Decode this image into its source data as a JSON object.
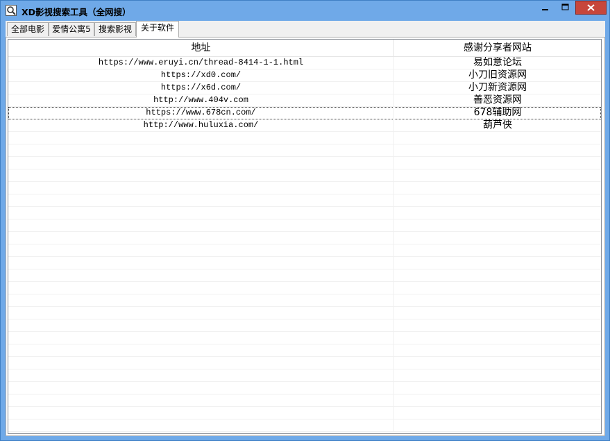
{
  "window": {
    "title": "XD影视搜索工具（全网搜）",
    "controls": {
      "minimize": "–",
      "maximize": "□",
      "close": "✕"
    }
  },
  "tabs": [
    {
      "label": "全部电影",
      "active": false
    },
    {
      "label": "爱情公寓5",
      "active": false
    },
    {
      "label": "搜索影视",
      "active": false
    },
    {
      "label": "关于软件",
      "active": true
    }
  ],
  "table": {
    "columns": [
      "地址",
      "感谢分享者网站"
    ],
    "rows": [
      [
        "https://www.eruyi.cn/thread-8414-1-1.html",
        "易如意论坛"
      ],
      [
        "https://xd0.com/",
        "小刀旧资源网"
      ],
      [
        "https://x6d.com/",
        "小刀新资源网"
      ],
      [
        "http://www.404v.com",
        "善恶资源网"
      ],
      [
        "https://www.678cn.com/",
        "678辅助网"
      ],
      [
        "http://www.huluxia.com/",
        "葫芦侠"
      ]
    ],
    "focused_row": 4
  }
}
